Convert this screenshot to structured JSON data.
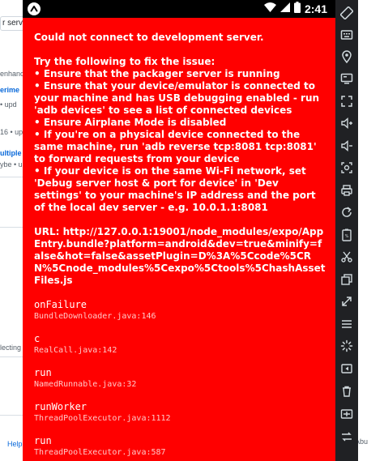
{
  "background_page": {
    "fragments": [
      {
        "text": "r serv",
        "kind": "search"
      },
      {
        "text": "enhanco",
        "kind": "text"
      },
      {
        "text": "erime",
        "kind": "link"
      },
      {
        "text": "• upd",
        "kind": "text"
      },
      {
        "text": "16 • upd",
        "kind": "text"
      },
      {
        "text": "ultiple",
        "kind": "link"
      },
      {
        "text": "ybe • upd",
        "kind": "text"
      },
      {
        "text": "lecting",
        "kind": "text"
      },
      {
        "text": "Help",
        "kind": "help"
      }
    ],
    "right_text": "Abu"
  },
  "status_bar": {
    "time": "2:41",
    "app_icon": "a-icon"
  },
  "error": {
    "title": "Could not connect to development server.",
    "intro": "Try the following to fix the issue:",
    "tips": [
      "• Ensure that the packager server is running",
      "• Ensure that your device/emulator is connected to your machine and has USB debugging enabled - run 'adb devices' to see a list of connected devices",
      "• Ensure Airplane Mode is disabled",
      "• If you're on a physical device connected to the same machine, run 'adb reverse tcp:8081 tcp:8081' to forward requests from your device",
      "• If your device is on the same Wi-Fi network, set 'Debug server host & port for device' in 'Dev settings' to your machine's IP address and the port of the local dev server - e.g. 10.0.1.1:8081"
    ],
    "url": "URL: http://127.0.0.1:19001/node_modules/expo/AppEntry.bundle?platform=android&dev=true&minify=false&hot=false&assetPlugin=D%3A%5Ccode%5CRN%5Cnode_modules%5Cexpo%5Ctools%5ChashAssetFiles.js",
    "stack": [
      {
        "method": "onFailure",
        "file": "BundleDownloader.java:146"
      },
      {
        "method": "c",
        "file": "RealCall.java:142"
      },
      {
        "method": "run",
        "file": "NamedRunnable.java:32"
      },
      {
        "method": "runWorker",
        "file": "ThreadPoolExecutor.java:1112"
      },
      {
        "method": "run",
        "file": "ThreadPoolExecutor.java:587"
      }
    ]
  },
  "toolbar": {
    "buttons": [
      "rotate-icon",
      "keyboard-icon",
      "location-icon",
      "screen-icon",
      "fullscreen-icon",
      "volume-up-icon",
      "volume-down-icon",
      "screenshot-icon",
      "print-icon",
      "reload-icon",
      "battery-icon",
      "scissors-icon",
      "layers-icon",
      "resize-icon",
      "menu-icon",
      "loading-icon",
      "back-icon",
      "trash-icon",
      "media-icon",
      "more-icon"
    ]
  }
}
